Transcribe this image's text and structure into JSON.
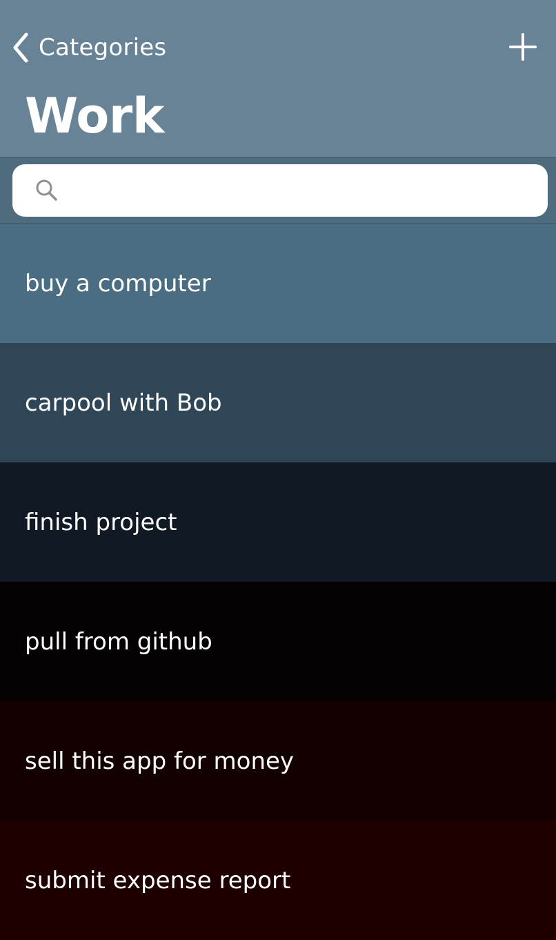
{
  "nav": {
    "back_label": "Categories",
    "title": "Work",
    "add_icon": "plus-icon",
    "back_icon": "chevron-left-icon",
    "background": "#678395"
  },
  "search": {
    "placeholder": "",
    "value": "",
    "icon": "search-icon",
    "bar_background": "#4f6b7e"
  },
  "items": [
    {
      "label": "buy a computer",
      "color": "#4a6d82"
    },
    {
      "label": "carpool with Bob",
      "color": "#2f4656"
    },
    {
      "label": "finish project",
      "color": "#111a24"
    },
    {
      "label": "pull from github",
      "color": "#040202"
    },
    {
      "label": "sell this app for money",
      "color": "#130000"
    },
    {
      "label": "submit expense report",
      "color": "#1f0000"
    }
  ]
}
